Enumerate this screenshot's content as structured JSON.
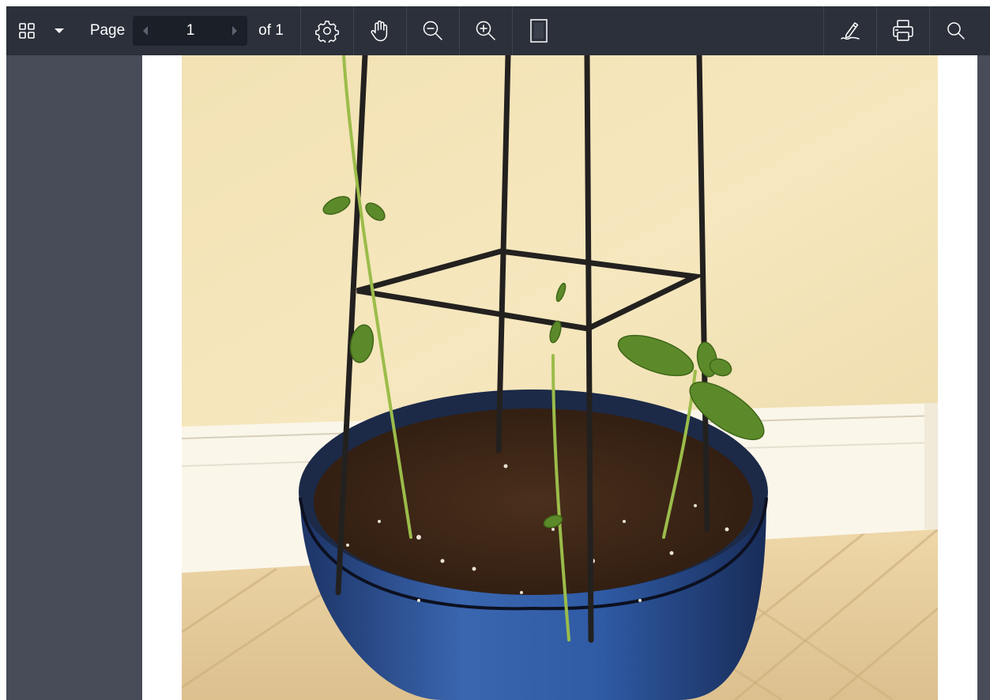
{
  "toolbar": {
    "page_label": "Page",
    "current_page": "1",
    "of_label": "of 1",
    "icons": [
      "thumbnails-grid-icon",
      "caret-down-icon",
      "prev-page-icon",
      "next-page-icon",
      "settings-gear-icon",
      "hand-pan-icon",
      "zoom-out-icon",
      "zoom-in-icon",
      "fit-page-icon",
      "pen-sign-icon",
      "print-icon",
      "search-icon"
    ]
  },
  "document": {
    "content": "photo-of-seedlings-in-blue-pot-with-trellis"
  },
  "colors": {
    "toolbar_bg": "#2b303a",
    "viewer_bg": "#474c58",
    "pager_bg": "#1b1f27",
    "page_bg": "#ffffff"
  }
}
